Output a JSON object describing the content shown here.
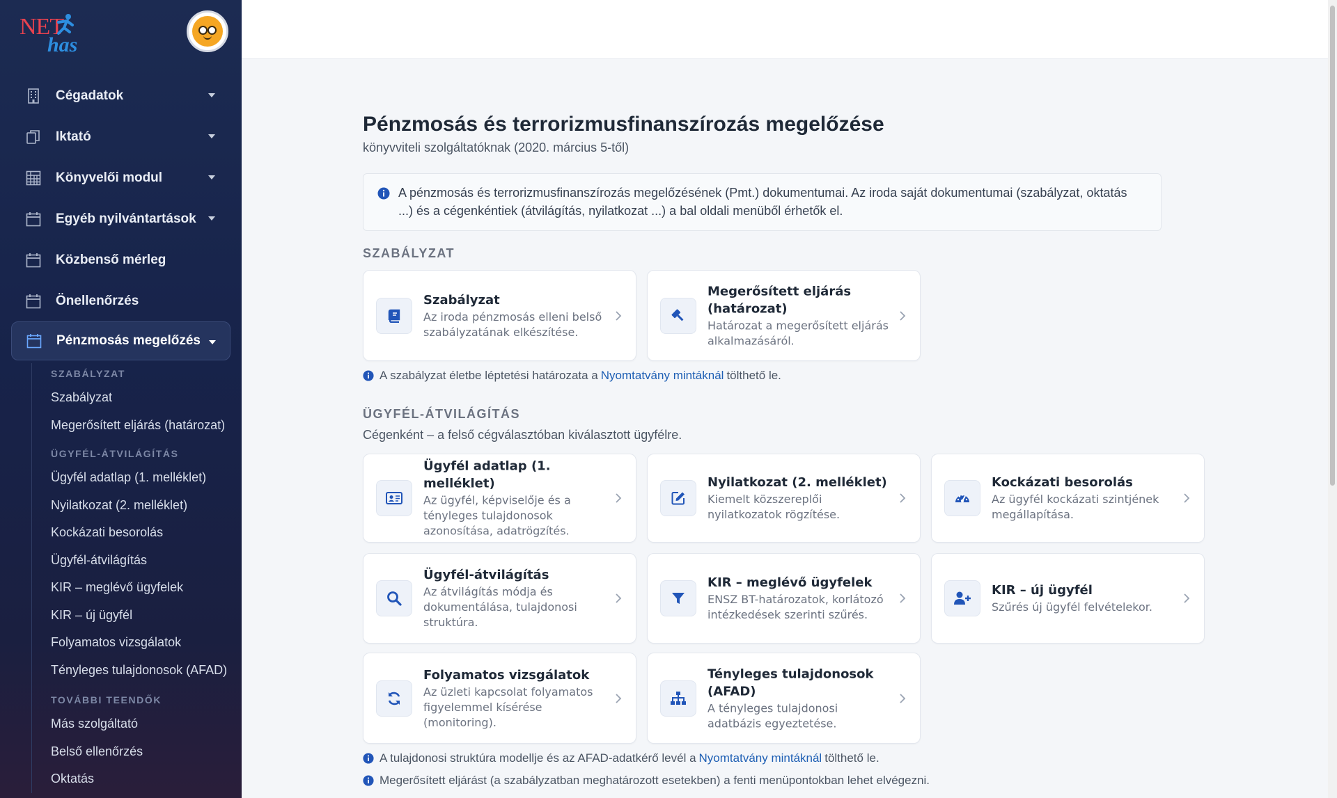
{
  "logo": {
    "net": "NET",
    "has": "has"
  },
  "nav": {
    "items": [
      {
        "label": "Cégadatok",
        "icon": "building-icon",
        "caret": true
      },
      {
        "label": "Iktató",
        "icon": "documents-icon",
        "caret": true
      },
      {
        "label": "Könyvelői modul",
        "icon": "grid-table-icon",
        "caret": true
      },
      {
        "label": "Egyéb nyilvántartások",
        "icon": "calendar-icon",
        "caret": true
      },
      {
        "label": "Közbenső mérleg",
        "icon": "calendar-icon",
        "caret": false
      },
      {
        "label": "Önellenőrzés",
        "icon": "calendar-icon",
        "caret": false
      },
      {
        "label": "Pénzmosás megelőzés",
        "icon": "calendar-icon",
        "caret": true,
        "active": true
      }
    ],
    "sub": {
      "heading_1": "SZABÁLYZAT",
      "group_1": [
        "Szabályzat",
        "Megerősített eljárás (határozat)"
      ],
      "heading_2": "ÜGYFÉL-ÁTVILÁGÍTÁS",
      "group_2": [
        "Ügyfél adatlap (1. melléklet)",
        "Nyilatkozat (2. melléklet)",
        "Kockázati besorolás",
        "Ügyfél-átvilágítás",
        "KIR – meglévő ügyfelek",
        "KIR – új ügyfél",
        "Folyamatos vizsgálatok",
        "Tényleges tulajdonosok (AFAD)"
      ],
      "heading_3": "TOVÁBBI TEENDŐK",
      "group_3": [
        "Más szolgáltató",
        "Belső ellenőrzés",
        "Oktatás"
      ]
    }
  },
  "page": {
    "title": "Pénzmosás és terrorizmusfinanszírozás megelőzése",
    "subtitle": "könyvviteli szolgáltatóknak (2020. március 5-től)",
    "info_line1": "A pénzmosás és terrorizmusfinanszírozás megelőzésének (Pmt.) dokumentumai. Az iroda saját dokumentumai (szabályzat, oktatás",
    "info_line2": "...) és a cégenkéntiek (átvilágítás, nyilatkozat ...) a bal oldali menüből érhetők el."
  },
  "section1": {
    "title": "SZABÁLYZAT",
    "cards": [
      {
        "title": "Szabályzat",
        "desc": "Az iroda pénzmosás elleni belső szabályzatának elkészítése.",
        "icon": "book-icon"
      },
      {
        "title": "Megerősített eljárás (határozat)",
        "desc": "Határozat a megerősített eljárás alkalmazásáról.",
        "icon": "gavel-icon"
      }
    ],
    "note_before": "A szabályzat életbe léptetési határozata a",
    "note_link": "Nyomtatvány mintáknál",
    "note_after": "tölthető le."
  },
  "section2": {
    "title": "ÜGYFÉL-ÁTVILÁGÍTÁS",
    "desc": "Cégenként – a felső cégválasztóban kiválasztott ügyfélre.",
    "cards": [
      {
        "title": "Ügyfél adatlap (1. melléklet)",
        "desc": "Az ügyfél, képviselője és a tényleges tulajdonosok azonosítása, adatrögzítés.",
        "icon": "id-card-icon"
      },
      {
        "title": "Nyilatkozat (2. melléklet)",
        "desc": "Kiemelt közszereplői nyilatkozatok rögzítése.",
        "icon": "edit-icon"
      },
      {
        "title": "Kockázati besorolás",
        "desc": "Az ügyfél kockázati szintjének megállapítása.",
        "icon": "gauge-icon"
      },
      {
        "title": "Ügyfél-átvilágítás",
        "desc": "Az átvilágítás módja és dokumentálása, tulajdonosi struktúra.",
        "icon": "search-icon"
      },
      {
        "title": "KIR – meglévő ügyfelek",
        "desc": "ENSZ BT-határozatok, korlátozó intézkedések szerinti szűrés.",
        "icon": "filter-icon"
      },
      {
        "title": "KIR – új ügyfél",
        "desc": "Szűrés új ügyfél felvételekor.",
        "icon": "user-plus-icon"
      },
      {
        "title": "Folyamatos vizsgálatok",
        "desc": "Az üzleti kapcsolat folyamatos figyelemmel kísérése (monitoring).",
        "icon": "refresh-icon"
      },
      {
        "title": "Tényleges tulajdonosok (AFAD)",
        "desc": "A tényleges tulajdonosi adatbázis egyeztetése.",
        "icon": "org-chart-icon"
      }
    ],
    "note1_before": "A tulajdonosi struktúra modellje és az AFAD-adatkérő levél a",
    "note1_link": "Nyomtatvány mintáknál",
    "note1_after": "tölthető le.",
    "note2": "Megerősített eljárást (a szabályzatban meghatározott esetekben) a fenti menüpontokban lehet elvégezni."
  },
  "colors": {
    "sidebar_bg": "#1c2b52",
    "accent": "#2155b8",
    "link": "#1e5fb4"
  }
}
